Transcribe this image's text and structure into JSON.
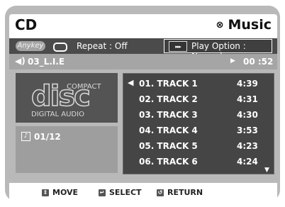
{
  "header": {
    "title": "CD",
    "mode_label": "Music",
    "mode_icon": "disc-icon"
  },
  "repeat_bar": {
    "anykey_label": "Anykey",
    "repeat_text": "Repeat : Off",
    "play_option_text": "Play Option : Normal",
    "play_option_icon_text": "▸▸▸"
  },
  "status": {
    "current_track": "03_L.I.E",
    "elapsed": "00 :52"
  },
  "disc": {
    "logo_main": "disc",
    "logo_top": "COMPACT",
    "logo_bottom": "DIGITAL AUDIO",
    "counter": "01/12"
  },
  "tracks": [
    {
      "name": "01. TRACK 1",
      "time": "4:39",
      "selected": true
    },
    {
      "name": "02. TRACK 2",
      "time": "4:31",
      "selected": false
    },
    {
      "name": "03. TRACK 3",
      "time": "4:30",
      "selected": false
    },
    {
      "name": "04. TRACK 4",
      "time": "3:53",
      "selected": false
    },
    {
      "name": "05. TRACK 5",
      "time": "4:23",
      "selected": false
    },
    {
      "name": "06. TRACK 6",
      "time": "4:24",
      "selected": false
    }
  ],
  "help": {
    "move": "MOVE",
    "select": "SELECT",
    "return": "RETURN"
  },
  "colors": {
    "frame": "#b9b9b9",
    "panel_dark": "#454545",
    "bar_dark": "#4b4b4b",
    "bar_light": "#a5a5a5"
  }
}
